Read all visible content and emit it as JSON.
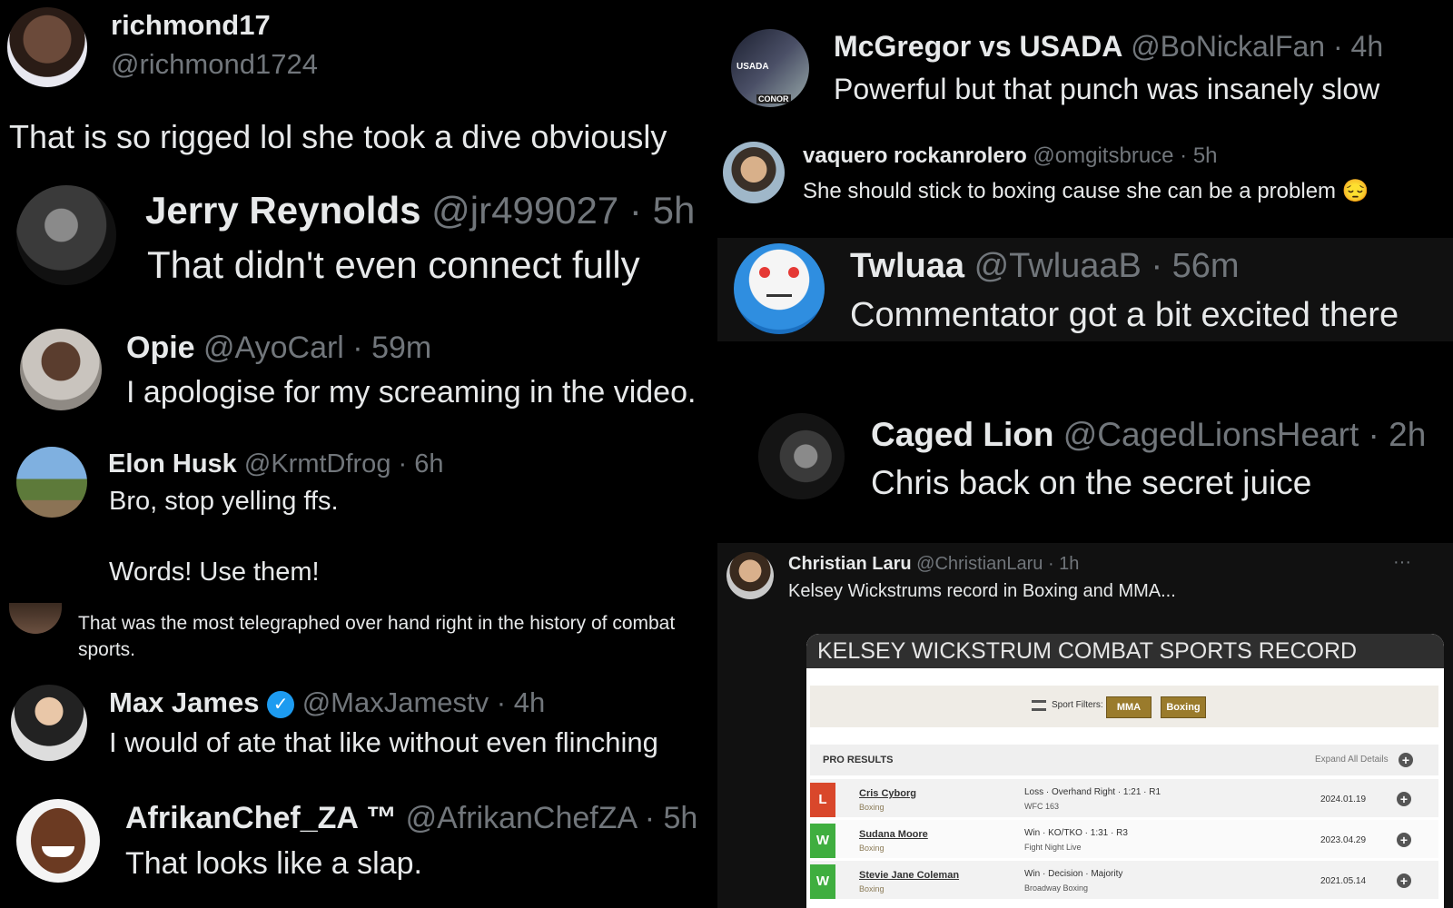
{
  "left_posts": [
    {
      "name": "richmond17",
      "handle": "@richmond1724",
      "text": "That is so rigged lol she took a dive obviously"
    },
    {
      "name": "Jerry Reynolds",
      "handle": "@jr499027 · 5h",
      "text": "That didn't even connect fully"
    },
    {
      "name": "Opie",
      "handle": "@AyoCarl · 59m",
      "text": "I apologise for my screaming in the video."
    },
    {
      "name": "Elon Husk",
      "handle": "@KrmtDfrog · 6h",
      "text": "Bro, stop yelling ffs.",
      "text2": "Words! Use them!"
    },
    {
      "name": "",
      "handle": "",
      "text": "That was the most telegraphed over hand right in the history of combat",
      "text2": "sports."
    },
    {
      "name": "Max James",
      "handle": "@MaxJamestv · 4h",
      "text": "I would of ate that like without even flinching"
    },
    {
      "name": "AfrikanChef_ZA ™",
      "handle": "@AfrikanChefZA · 5h",
      "text": "That looks like a slap."
    }
  ],
  "right_posts": [
    {
      "name": "McGregor vs USADA",
      "handle": "@BoNickalFan · 4h",
      "text": "Powerful but that punch was insanely slow",
      "avatar_text_top": "USADA",
      "avatar_text_bottom": "CONOR"
    },
    {
      "name": "vaquero rockanrolero",
      "handle": "@omgitsbruce · 5h",
      "text": "She should stick to boxing cause she can be a problem 😔"
    },
    {
      "name": "Twluaa",
      "handle": "@TwluaaB · 56m",
      "text": "Commentator got a bit excited there"
    },
    {
      "name": "Caged Lion",
      "handle": "@CagedLionsHeart · 2h",
      "text": "Chris back on the secret juice"
    },
    {
      "name": "Christian Laru",
      "handle": "@ChristianLaru · 1h",
      "text": "Kelsey Wickstrums record in Boxing and MMA...",
      "more": "···"
    }
  ],
  "record": {
    "title": "KELSEY WICKSTRUM COMBAT SPORTS RECORD",
    "filter_label": "Sport Filters:",
    "filters": [
      "MMA",
      "Boxing"
    ],
    "section": "PRO RESULTS",
    "expand": "Expand All Details",
    "rows": [
      {
        "result": "L",
        "opponent": "Cris Cyborg",
        "sport": "Boxing",
        "method": "Loss · Overhand Right · 1:21 · R1",
        "event": "WFC 163",
        "date": "2024.01.19",
        "color": "#d9472b"
      },
      {
        "result": "W",
        "opponent": "Sudana Moore",
        "sport": "Boxing",
        "method": "Win · KO/TKO · 1:31 · R3",
        "event": "Fight Night Live",
        "date": "2023.04.29",
        "color": "#3fae3f"
      },
      {
        "result": "W",
        "opponent": "Stevie Jane Coleman",
        "sport": "Boxing",
        "method": "Win · Decision · Majority",
        "event": "Broadway Boxing",
        "date": "2021.05.14",
        "color": "#3fae3f"
      }
    ]
  },
  "colors": {
    "bg": "#000000",
    "text": "#e7e9ea",
    "muted": "#71767b",
    "verified": "#1d9bf0"
  }
}
